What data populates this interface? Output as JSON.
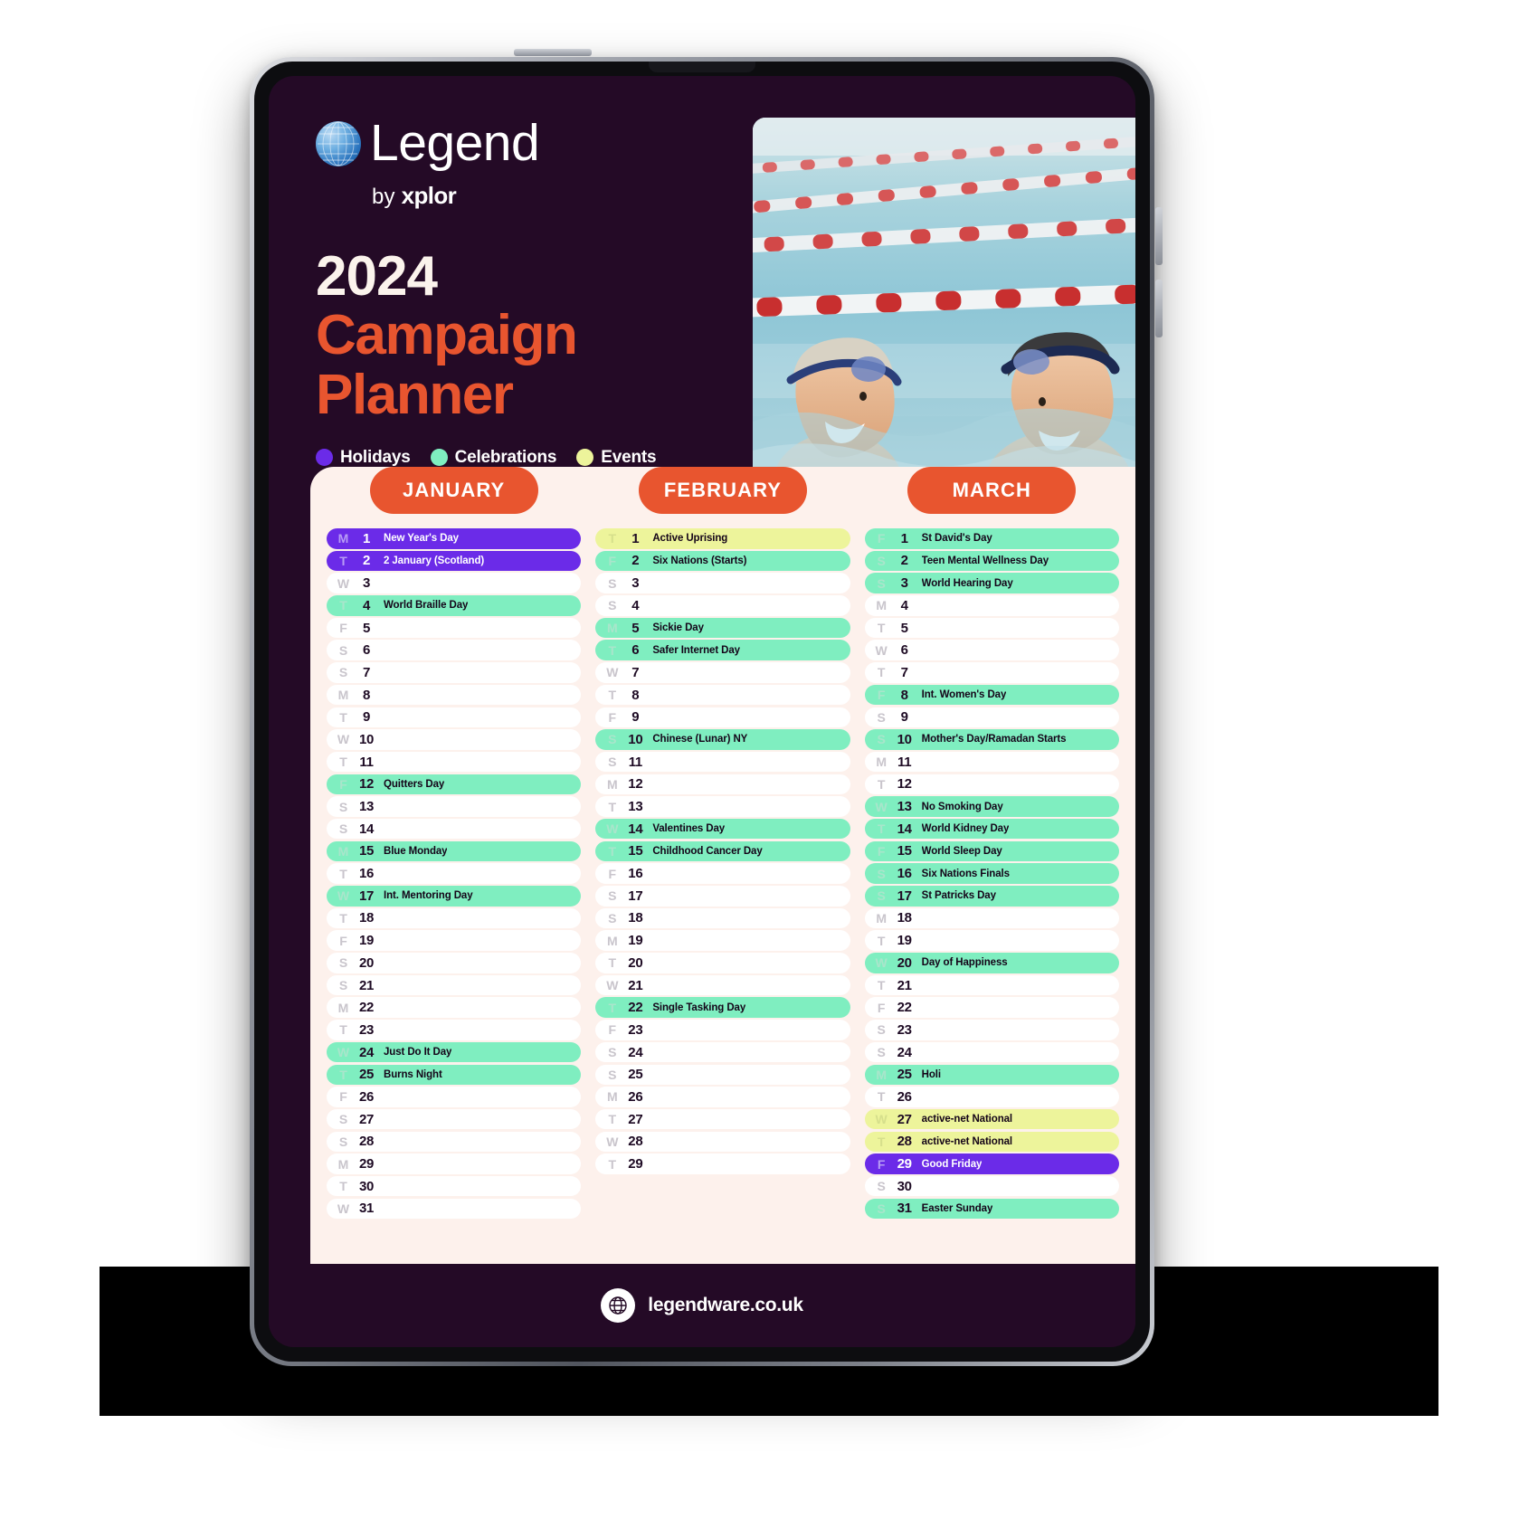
{
  "brand": {
    "logo_word": "Legend",
    "byline_prefix": "by ",
    "byline_brand": "xplor",
    "globe_icon": "globe-icon"
  },
  "title": {
    "year": "2024",
    "line1": "Campaign",
    "line2": "Planner"
  },
  "legend": {
    "items": [
      {
        "label": "Holidays",
        "color": "#6B2BE8"
      },
      {
        "label": "Celebrations",
        "color": "#7FEEC0"
      },
      {
        "label": "Events",
        "color": "#EDF49B"
      }
    ]
  },
  "photo": {
    "alt": "Two smiling senior swimmers in a lane pool"
  },
  "footer": {
    "url": "legendware.co.uk",
    "icon": "globe-icon"
  },
  "months": [
    {
      "name": "JANUARY",
      "days": [
        {
          "dow": "M",
          "num": "1",
          "label": "New Year's Day",
          "type": "holiday"
        },
        {
          "dow": "T",
          "num": "2",
          "label": "2 January (Scotland)",
          "type": "holiday"
        },
        {
          "dow": "W",
          "num": "3",
          "label": "",
          "type": "none"
        },
        {
          "dow": "T",
          "num": "4",
          "label": "World Braille Day",
          "type": "celebration"
        },
        {
          "dow": "F",
          "num": "5",
          "label": "",
          "type": "none"
        },
        {
          "dow": "S",
          "num": "6",
          "label": "",
          "type": "none"
        },
        {
          "dow": "S",
          "num": "7",
          "label": "",
          "type": "none"
        },
        {
          "dow": "M",
          "num": "8",
          "label": "",
          "type": "none"
        },
        {
          "dow": "T",
          "num": "9",
          "label": "",
          "type": "none"
        },
        {
          "dow": "W",
          "num": "10",
          "label": "",
          "type": "none"
        },
        {
          "dow": "T",
          "num": "11",
          "label": "",
          "type": "none"
        },
        {
          "dow": "F",
          "num": "12",
          "label": "Quitters Day",
          "type": "celebration"
        },
        {
          "dow": "S",
          "num": "13",
          "label": "",
          "type": "none"
        },
        {
          "dow": "S",
          "num": "14",
          "label": "",
          "type": "none"
        },
        {
          "dow": "M",
          "num": "15",
          "label": "Blue Monday",
          "type": "celebration"
        },
        {
          "dow": "T",
          "num": "16",
          "label": "",
          "type": "none"
        },
        {
          "dow": "W",
          "num": "17",
          "label": "Int. Mentoring Day",
          "type": "celebration"
        },
        {
          "dow": "T",
          "num": "18",
          "label": "",
          "type": "none"
        },
        {
          "dow": "F",
          "num": "19",
          "label": "",
          "type": "none"
        },
        {
          "dow": "S",
          "num": "20",
          "label": "",
          "type": "none"
        },
        {
          "dow": "S",
          "num": "21",
          "label": "",
          "type": "none"
        },
        {
          "dow": "M",
          "num": "22",
          "label": "",
          "type": "none"
        },
        {
          "dow": "T",
          "num": "23",
          "label": "",
          "type": "none"
        },
        {
          "dow": "W",
          "num": "24",
          "label": "Just Do It Day",
          "type": "celebration"
        },
        {
          "dow": "T",
          "num": "25",
          "label": "Burns Night",
          "type": "celebration"
        },
        {
          "dow": "F",
          "num": "26",
          "label": "",
          "type": "none"
        },
        {
          "dow": "S",
          "num": "27",
          "label": "",
          "type": "none"
        },
        {
          "dow": "S",
          "num": "28",
          "label": "",
          "type": "none"
        },
        {
          "dow": "M",
          "num": "29",
          "label": "",
          "type": "none"
        },
        {
          "dow": "T",
          "num": "30",
          "label": "",
          "type": "none"
        },
        {
          "dow": "W",
          "num": "31",
          "label": "",
          "type": "none"
        }
      ]
    },
    {
      "name": "FEBRUARY",
      "days": [
        {
          "dow": "T",
          "num": "1",
          "label": "Active Uprising",
          "type": "event"
        },
        {
          "dow": "F",
          "num": "2",
          "label": "Six Nations (Starts)",
          "type": "celebration"
        },
        {
          "dow": "S",
          "num": "3",
          "label": "",
          "type": "none"
        },
        {
          "dow": "S",
          "num": "4",
          "label": "",
          "type": "none"
        },
        {
          "dow": "M",
          "num": "5",
          "label": "Sickie Day",
          "type": "celebration"
        },
        {
          "dow": "T",
          "num": "6",
          "label": "Safer Internet Day",
          "type": "celebration"
        },
        {
          "dow": "W",
          "num": "7",
          "label": "",
          "type": "none"
        },
        {
          "dow": "T",
          "num": "8",
          "label": "",
          "type": "none"
        },
        {
          "dow": "F",
          "num": "9",
          "label": "",
          "type": "none"
        },
        {
          "dow": "S",
          "num": "10",
          "label": "Chinese (Lunar) NY",
          "type": "celebration"
        },
        {
          "dow": "S",
          "num": "11",
          "label": "",
          "type": "none"
        },
        {
          "dow": "M",
          "num": "12",
          "label": "",
          "type": "none"
        },
        {
          "dow": "T",
          "num": "13",
          "label": "",
          "type": "none"
        },
        {
          "dow": "W",
          "num": "14",
          "label": "Valentines Day",
          "type": "celebration"
        },
        {
          "dow": "T",
          "num": "15",
          "label": "Childhood Cancer Day",
          "type": "celebration"
        },
        {
          "dow": "F",
          "num": "16",
          "label": "",
          "type": "none"
        },
        {
          "dow": "S",
          "num": "17",
          "label": "",
          "type": "none"
        },
        {
          "dow": "S",
          "num": "18",
          "label": "",
          "type": "none"
        },
        {
          "dow": "M",
          "num": "19",
          "label": "",
          "type": "none"
        },
        {
          "dow": "T",
          "num": "20",
          "label": "",
          "type": "none"
        },
        {
          "dow": "W",
          "num": "21",
          "label": "",
          "type": "none"
        },
        {
          "dow": "T",
          "num": "22",
          "label": "Single Tasking Day",
          "type": "celebration"
        },
        {
          "dow": "F",
          "num": "23",
          "label": "",
          "type": "none"
        },
        {
          "dow": "S",
          "num": "24",
          "label": "",
          "type": "none"
        },
        {
          "dow": "S",
          "num": "25",
          "label": "",
          "type": "none"
        },
        {
          "dow": "M",
          "num": "26",
          "label": "",
          "type": "none"
        },
        {
          "dow": "T",
          "num": "27",
          "label": "",
          "type": "none"
        },
        {
          "dow": "W",
          "num": "28",
          "label": "",
          "type": "none"
        },
        {
          "dow": "T",
          "num": "29",
          "label": "",
          "type": "none"
        }
      ]
    },
    {
      "name": "MARCH",
      "days": [
        {
          "dow": "F",
          "num": "1",
          "label": "St David's Day",
          "type": "celebration"
        },
        {
          "dow": "S",
          "num": "2",
          "label": "Teen Mental Wellness Day",
          "type": "celebration"
        },
        {
          "dow": "S",
          "num": "3",
          "label": "World Hearing Day",
          "type": "celebration"
        },
        {
          "dow": "M",
          "num": "4",
          "label": "",
          "type": "none"
        },
        {
          "dow": "T",
          "num": "5",
          "label": "",
          "type": "none"
        },
        {
          "dow": "W",
          "num": "6",
          "label": "",
          "type": "none"
        },
        {
          "dow": "T",
          "num": "7",
          "label": "",
          "type": "none"
        },
        {
          "dow": "F",
          "num": "8",
          "label": "Int. Women's Day",
          "type": "celebration"
        },
        {
          "dow": "S",
          "num": "9",
          "label": "",
          "type": "none"
        },
        {
          "dow": "S",
          "num": "10",
          "label": "Mother's Day/Ramadan Starts",
          "type": "celebration"
        },
        {
          "dow": "M",
          "num": "11",
          "label": "",
          "type": "none"
        },
        {
          "dow": "T",
          "num": "12",
          "label": "",
          "type": "none"
        },
        {
          "dow": "W",
          "num": "13",
          "label": "No Smoking Day",
          "type": "celebration"
        },
        {
          "dow": "T",
          "num": "14",
          "label": "World Kidney Day",
          "type": "celebration"
        },
        {
          "dow": "F",
          "num": "15",
          "label": "World Sleep Day",
          "type": "celebration"
        },
        {
          "dow": "S",
          "num": "16",
          "label": "Six Nations Finals",
          "type": "celebration"
        },
        {
          "dow": "S",
          "num": "17",
          "label": "St Patricks Day",
          "type": "celebration"
        },
        {
          "dow": "M",
          "num": "18",
          "label": "",
          "type": "none"
        },
        {
          "dow": "T",
          "num": "19",
          "label": "",
          "type": "none"
        },
        {
          "dow": "W",
          "num": "20",
          "label": "Day of Happiness",
          "type": "celebration"
        },
        {
          "dow": "T",
          "num": "21",
          "label": "",
          "type": "none"
        },
        {
          "dow": "F",
          "num": "22",
          "label": "",
          "type": "none"
        },
        {
          "dow": "S",
          "num": "23",
          "label": "",
          "type": "none"
        },
        {
          "dow": "S",
          "num": "24",
          "label": "",
          "type": "none"
        },
        {
          "dow": "M",
          "num": "25",
          "label": "Holi",
          "type": "celebration"
        },
        {
          "dow": "T",
          "num": "26",
          "label": "",
          "type": "none"
        },
        {
          "dow": "W",
          "num": "27",
          "label": "active-net National",
          "type": "event"
        },
        {
          "dow": "T",
          "num": "28",
          "label": "active-net National",
          "type": "event"
        },
        {
          "dow": "F",
          "num": "29",
          "label": "Good Friday",
          "type": "holiday"
        },
        {
          "dow": "S",
          "num": "30",
          "label": "",
          "type": "none"
        },
        {
          "dow": "S",
          "num": "31",
          "label": "Easter Sunday",
          "type": "celebration"
        }
      ]
    }
  ]
}
